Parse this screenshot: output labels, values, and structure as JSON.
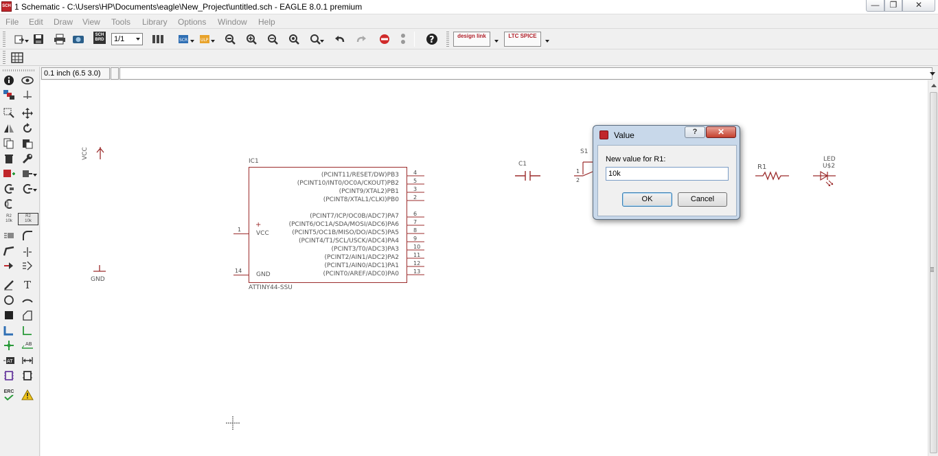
{
  "window": {
    "app_icon": "eagle-sch-icon",
    "title": "1 Schematic - C:\\Users\\HP\\Documents\\eagle\\New_Project\\untitled.sch - EAGLE 8.0.1 premium"
  },
  "menu": [
    "File",
    "Edit",
    "Draw",
    "View",
    "Tools",
    "Library",
    "Options",
    "Window",
    "Help"
  ],
  "toolbar": {
    "sheet_select": "1/1",
    "sch_brd_label": "SCH BRD",
    "scr_label": "SCR",
    "ulp_label": "ULP",
    "designlink_label": "design link",
    "ltspice_label": "LTC SPICE"
  },
  "command_bar": {
    "coordinate": "0.1 inch (6.5 3.0)",
    "command_value": ""
  },
  "schematic": {
    "vcc_label": "VCC",
    "gnd_label": "GND",
    "ic": {
      "name": "IC1",
      "part": "ATTINY44-SSU",
      "left_pins": [
        {
          "num": "1",
          "label": "VCC",
          "plus": "+"
        },
        {
          "num": "14",
          "label": "GND"
        }
      ],
      "right_pins": [
        {
          "label": "(PCINT11/RESET/DW)PB3",
          "num": "4"
        },
        {
          "label": "(PCINT10/INT0/OC0A/CKOUT)PB2",
          "num": "5"
        },
        {
          "label": "(PCINT9/XTAL2)PB1",
          "num": "3"
        },
        {
          "label": "(PCINT8/XTAL1/CLKI)PB0",
          "num": "2"
        },
        {
          "label": "(PCINT7/ICP/OC0B/ADC7)PA7",
          "num": "6"
        },
        {
          "label": "(PCINT6/OC1A/SDA/MOSI/ADC6)PA6",
          "num": "7"
        },
        {
          "label": "(PCINT5/OC1B/MISO/DO/ADC5)PA5",
          "num": "8"
        },
        {
          "label": "(PCINT4/T1/SCL/USCK/ADC4)PA4",
          "num": "9"
        },
        {
          "label": "(PCINT3/T0/ADC3)PA3",
          "num": "10"
        },
        {
          "label": "(PCINT2/AIN1/ADC2)PA2",
          "num": "11"
        },
        {
          "label": "(PCINT1/AIN0/ADC1)PA1",
          "num": "12"
        },
        {
          "label": "(PCINT0/AREF/ADC0)PA0",
          "num": "13"
        }
      ]
    },
    "c1_label": "C1",
    "s1_label": "S1",
    "s1_pin1": "1",
    "s1_pin2": "2",
    "r1_label": "R1",
    "led_label": "LED",
    "led_name": "U$2"
  },
  "dialog": {
    "title": "Value",
    "help_label": "?",
    "close_label": "✕",
    "prompt": "New value for R1:",
    "input_value": "10k",
    "ok_label": "OK",
    "cancel_label": "Cancel"
  },
  "lefttoolbar": {
    "value_icon_top": "R2",
    "value_icon_bottom": "10k",
    "erc_label": "ERC",
    "text_icon": "T"
  }
}
